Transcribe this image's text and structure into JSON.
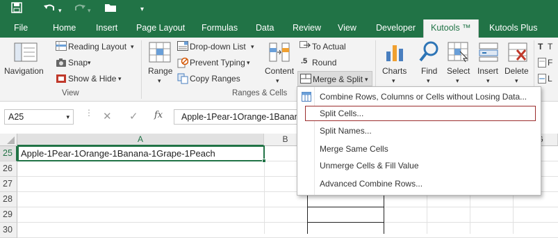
{
  "qat": {
    "save_icon": "save-icon",
    "undo_icon": "undo-icon",
    "redo_icon": "redo-icon",
    "open_icon": "open-icon",
    "customize_icon": "customize-qat-icon"
  },
  "tabs": [
    "File",
    "Home",
    "Insert",
    "Page Layout",
    "Formulas",
    "Data",
    "Review",
    "View",
    "Developer",
    "Kutools ™",
    "Kutools Plus"
  ],
  "ribbon": {
    "navigation": "Navigation",
    "reading_layout": "Reading Layout",
    "snap": "Snap",
    "show_hide": "Show & Hide",
    "view_group": "View",
    "range": "Range",
    "dropdown_list": "Drop-down List",
    "prevent_typing": "Prevent Typing",
    "copy_ranges": "Copy Ranges",
    "content": "Content",
    "to_actual": "To Actual",
    "round": "Round",
    "merge_split": "Merge & Split",
    "ranges_cells_group": "Ranges & Cells",
    "charts": "Charts",
    "find": "Find",
    "select": "Select",
    "insert": "Insert",
    "delete": "Delete",
    "t_partial": "T",
    "f_partial": "F",
    "l_partial": "L"
  },
  "formula_bar": {
    "name_box": "A25",
    "fx": "fx",
    "content": "Apple-1Pear-1Orange-1Banana-1Grape-1Peach"
  },
  "columns": [
    "A",
    "B",
    "G"
  ],
  "rows": [
    "25",
    "26",
    "27",
    "28",
    "29",
    "30"
  ],
  "cell_a25": "Apple-1Pear-1Orange-1Banana-1Grape-1Peach",
  "menu": {
    "items": [
      "Combine Rows, Columns or Cells without Losing Data...",
      "Split Cells...",
      "Split Names...",
      "Merge Same Cells",
      "Unmerge Cells & Fill Value",
      "Advanced Combine Rows..."
    ],
    "highlighted": "Split Cells..."
  },
  "colors": {
    "excel_green": "#217346",
    "highlight_border": "#9b2c2c"
  }
}
